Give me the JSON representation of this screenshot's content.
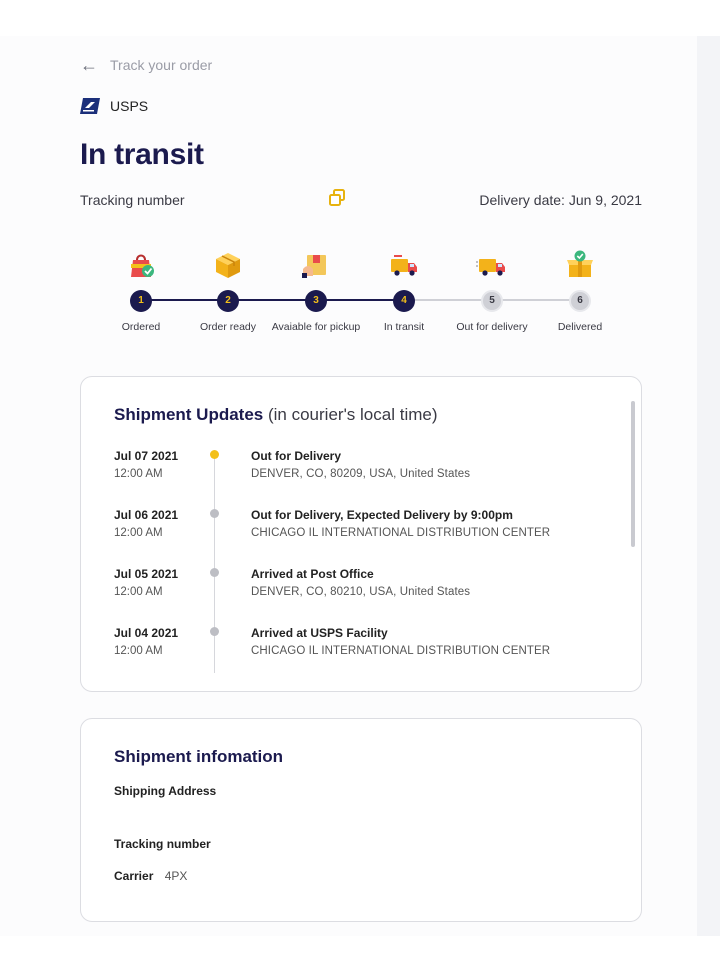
{
  "header": {
    "back_label": "Track your order",
    "carrier_name": "USPS",
    "status_title": "In transit",
    "tracking_label": "Tracking number",
    "delivery_date": "Delivery date: Jun 9, 2021"
  },
  "colors": {
    "brand_navy": "#1b1a4e",
    "accent_yellow": "#f3c01a",
    "inactive_gray": "#cfd0d6"
  },
  "steps": [
    {
      "number": "1",
      "label": "Ordered",
      "icon": "shopping-bag-icon",
      "done": true
    },
    {
      "number": "2",
      "label": "Order ready",
      "icon": "package-box-icon",
      "done": true
    },
    {
      "number": "3",
      "label": "Avaiable for pickup",
      "icon": "pickup-box-icon",
      "done": true
    },
    {
      "number": "4",
      "label": "In transit",
      "icon": "truck-icon",
      "done": true
    },
    {
      "number": "5",
      "label": "Out for delivery",
      "icon": "delivery-truck-icon",
      "done": false
    },
    {
      "number": "6",
      "label": "Delivered",
      "icon": "delivered-box-icon",
      "done": false
    }
  ],
  "updates": {
    "title": "Shipment Updates",
    "subtitle": "(in courier's local time)",
    "events": [
      {
        "date": "Jul 07 2021",
        "time": "12:00 AM",
        "title": "Out for Delivery",
        "location": "DENVER, CO, 80209, USA, United States",
        "current": true
      },
      {
        "date": "Jul 06 2021",
        "time": "12:00 AM",
        "title": "Out for Delivery, Expected Delivery by 9:00pm",
        "location": "CHICAGO IL INTERNATIONAL DISTRIBUTION CENTER",
        "current": false
      },
      {
        "date": "Jul 05 2021",
        "time": "12:00 AM",
        "title": "Arrived at Post Office",
        "location": "DENVER, CO, 80210, USA, United States",
        "current": false
      },
      {
        "date": "Jul 04 2021",
        "time": "12:00 AM",
        "title": "Arrived at USPS Facility",
        "location": "CHICAGO IL INTERNATIONAL DISTRIBUTION CENTER",
        "current": false
      }
    ]
  },
  "info": {
    "title": "Shipment infomation",
    "shipping_address_label": "Shipping Address",
    "tracking_number_label": "Tracking number",
    "carrier_label": "Carrier",
    "carrier_value": "4PX"
  }
}
